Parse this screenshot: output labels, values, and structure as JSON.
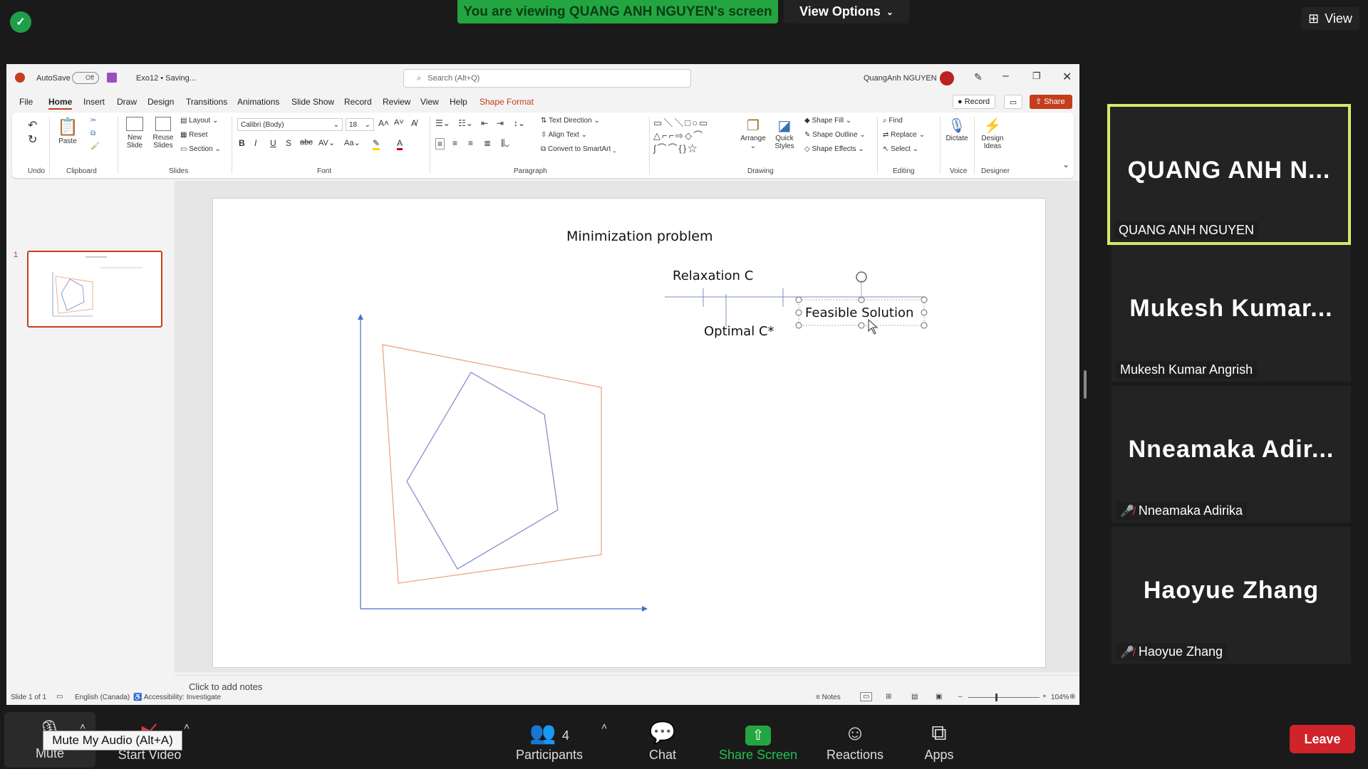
{
  "zoom": {
    "viewing_banner": "You are viewing QUANG ANH NGUYEN's screen",
    "view_options": "View Options",
    "view_button": "View",
    "participants": [
      {
        "big": "QUANG  ANH  N...",
        "name": "QUANG ANH NGUYEN",
        "muted": false,
        "active": true
      },
      {
        "big": "Mukesh  Kumar...",
        "name": "Mukesh Kumar Angrish",
        "muted": false,
        "active": false
      },
      {
        "big": "Nneamaka  Adir...",
        "name": "Nneamaka Adirika",
        "muted": true,
        "active": false
      },
      {
        "big": "Haoyue Zhang",
        "name": "Haoyue Zhang",
        "muted": true,
        "active": false
      }
    ],
    "bottom": {
      "mute": "Mute",
      "start_video": "Start Video",
      "participants": "Participants",
      "participants_count": "4",
      "chat": "Chat",
      "share_screen": "Share Screen",
      "reactions": "Reactions",
      "apps": "Apps",
      "leave": "Leave",
      "tooltip": "Mute My Audio (Alt+A)"
    },
    "colors": {
      "share_green": "#23a641",
      "leave_red": "#d0232a",
      "active_border": "#d7e86a"
    }
  },
  "ppt": {
    "autosave": "AutoSave",
    "autosave_state": "Off",
    "filename": "Exo12 • Saving...",
    "search_placeholder": "Search (Alt+Q)",
    "user": "QuangAnh NGUYEN",
    "record": "Record",
    "share": "Share",
    "tabs": [
      "File",
      "Home",
      "Insert",
      "Draw",
      "Design",
      "Transitions",
      "Animations",
      "Slide Show",
      "Record",
      "Review",
      "View",
      "Help",
      "Shape Format"
    ],
    "ribbon": {
      "undo_group": "Undo",
      "paste": "Paste",
      "clipboard": "Clipboard",
      "new_slide": "New Slide",
      "reuse_slides": "Reuse Slides",
      "layout": "Layout",
      "reset": "Reset",
      "section": "Section",
      "slides": "Slides",
      "font_name": "Calibri (Body)",
      "font_size": "18",
      "font": "Font",
      "text_direction": "Text Direction",
      "align_text": "Align Text",
      "convert_smartart": "Convert to SmartArt",
      "paragraph": "Paragraph",
      "arrange": "Arrange",
      "quick_styles": "Quick Styles",
      "shape_fill": "Shape Fill",
      "shape_outline": "Shape Outline",
      "shape_effects": "Shape Effects",
      "drawing": "Drawing",
      "find": "Find",
      "replace": "Replace",
      "select": "Select",
      "editing": "Editing",
      "dictate": "Dictate",
      "voice": "Voice",
      "design_ideas": "Design Ideas",
      "designer": "Designer"
    },
    "slide_number": "1",
    "slide": {
      "title": "Minimization problem",
      "relaxation": "Relaxation C",
      "optimal": "Optimal C*",
      "feasible": "Feasible Solution"
    },
    "notes_placeholder": "Click to add notes",
    "status": {
      "slide_of": "Slide 1 of 1",
      "language": "English (Canada)",
      "accessibility": "Accessibility: Investigate",
      "notes": "Notes",
      "zoom": "104%"
    },
    "colors": {
      "accent": "#c43e1c",
      "orange_polygon": "#e8a07a",
      "blue_polygon": "#7b86c8",
      "axis": "#4472c4"
    }
  }
}
